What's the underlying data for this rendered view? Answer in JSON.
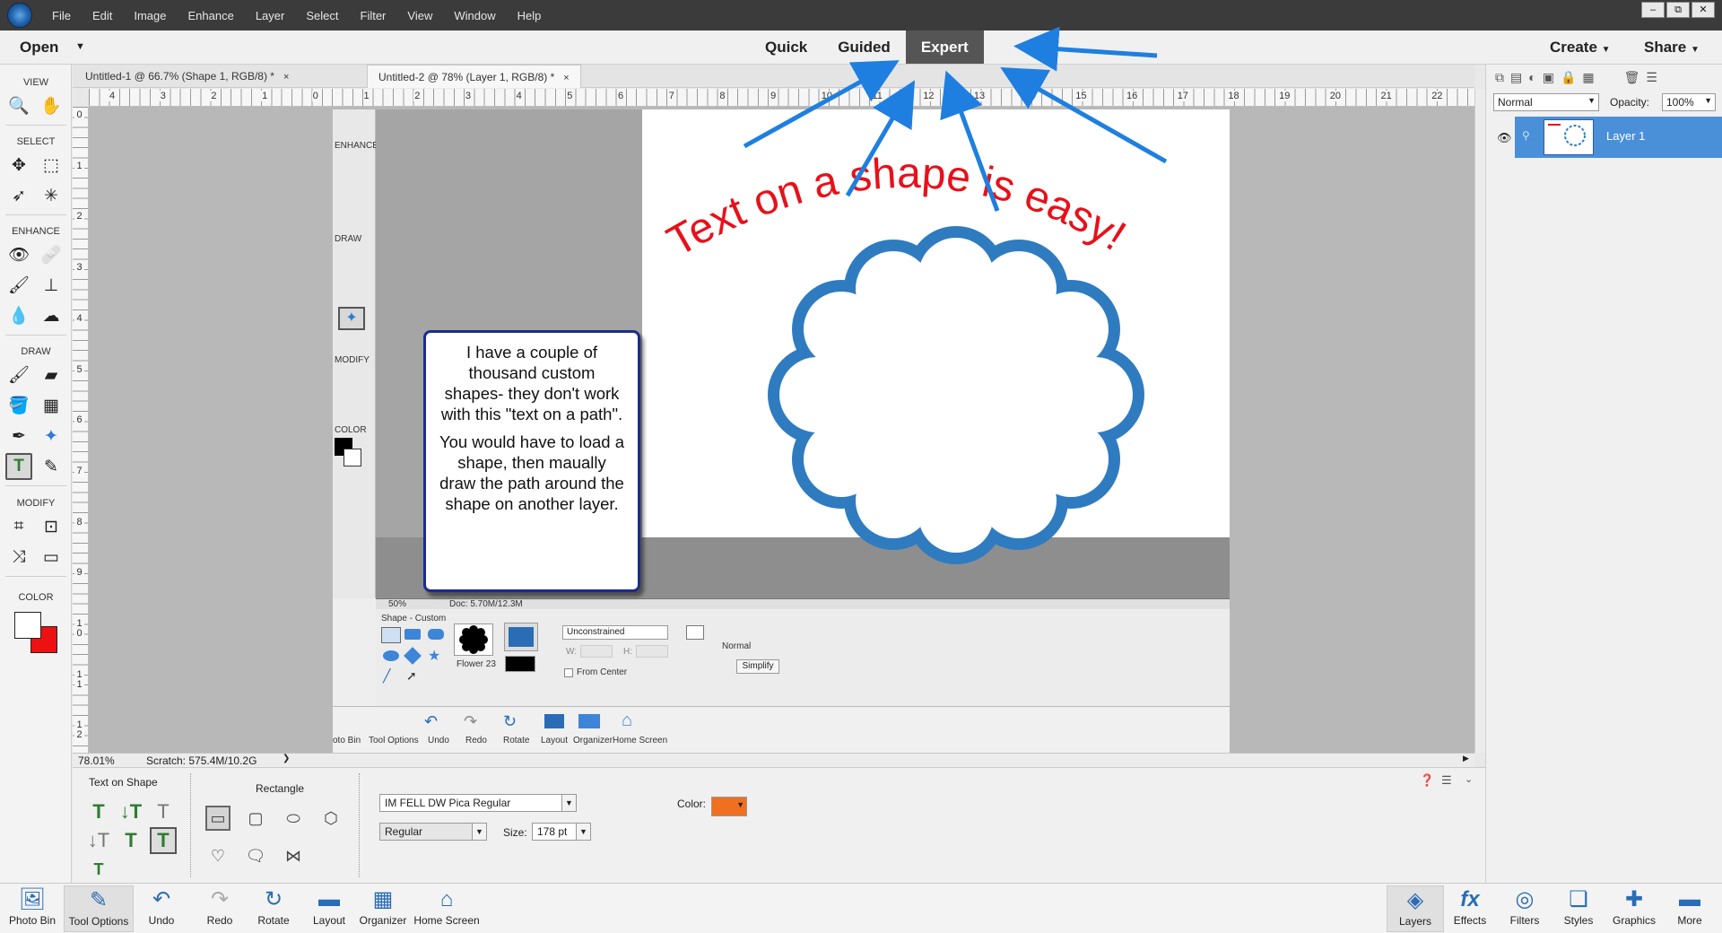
{
  "menu": {
    "items": [
      "File",
      "Edit",
      "Image",
      "Enhance",
      "Layer",
      "Select",
      "Filter",
      "View",
      "Window",
      "Help"
    ],
    "window_controls": [
      "–",
      "⧉",
      "✕"
    ]
  },
  "modebar": {
    "open_label": "Open",
    "tabs": [
      {
        "label": "Quick"
      },
      {
        "label": "Guided"
      },
      {
        "label": "Expert",
        "active": true
      }
    ],
    "create_label": "Create",
    "share_label": "Share"
  },
  "toolbox": {
    "sections": {
      "view": "VIEW",
      "select": "SELECT",
      "enhance": "ENHANCE",
      "draw": "DRAW",
      "modify": "MODIFY",
      "color": "COLOR"
    },
    "foreground_color": "#ffffff",
    "background_color": "#ee1111"
  },
  "documents": {
    "tabs": [
      {
        "title": "Untitled-1 @ 66.7% (Shape 1, RGB/8) *",
        "close": "×"
      },
      {
        "title": "Untitled-2 @ 78% (Layer 1, RGB/8) *",
        "close": "×",
        "active": true
      }
    ]
  },
  "ruler": {
    "h_labels": [
      "4",
      "3",
      "2",
      "1",
      "0",
      "1",
      "2",
      "3",
      "4",
      "5",
      "6",
      "7",
      "8",
      "9",
      "10",
      "11",
      "12",
      "13",
      "14",
      "15",
      "16",
      "17",
      "18",
      "19",
      "20",
      "21",
      "22"
    ],
    "v_labels": [
      "0",
      "1",
      "2",
      "3",
      "4",
      "5",
      "6",
      "7",
      "8",
      "9",
      "1 0",
      "1 1",
      "1 2"
    ]
  },
  "status": {
    "zoom": "78.01%",
    "scratch": "Scratch: 575.4M/10.2G"
  },
  "canvas_image": {
    "curved_text": "Text on a shape is easy!",
    "text_color": "#e8101a",
    "shape_outline_color": "#2f7bc0",
    "callout_paragraphs": [
      "I have a couple of thousand custom shapes- they don't work with this \"text on a path\".",
      "You would have to load a shape, then maually draw the path around the shape on another layer."
    ],
    "inner": {
      "panel_labels": [
        "ENHANCE",
        "DRAW",
        "MODIFY",
        "COLOR"
      ],
      "zoom": "50%",
      "doc": "Doc: 5.70M/12.3M",
      "shape_section": "Shape - Custom",
      "shape_name": "Flower 23",
      "constraint": "Unconstrained",
      "w_label": "W:",
      "h_label": "H:",
      "from_center": "From Center",
      "normal": "Normal",
      "simplify": "Simplify",
      "bottom_items": [
        "oto Bin",
        "Tool Options",
        "Undo",
        "Redo",
        "Rotate",
        "Layout",
        "Organizer",
        "Home Screen"
      ]
    }
  },
  "layers": {
    "blend_mode": "Normal",
    "opacity_label": "Opacity:",
    "opacity_value": "100%",
    "layer_name": "Layer 1"
  },
  "options": {
    "tool_name": "Text on Shape",
    "shape_label": "Rectangle",
    "font": "IM FELL DW Pica Regular",
    "style": "Regular",
    "size_label": "Size:",
    "size_value": "178 pt",
    "color_label": "Color:",
    "text_color": "#f07020"
  },
  "taskbar": {
    "left": [
      {
        "label": "Photo Bin",
        "icon": "photo-bin-icon"
      },
      {
        "label": "Tool Options",
        "icon": "tool-options-icon"
      },
      {
        "label": "Undo",
        "icon": "undo-icon"
      },
      {
        "label": "Redo",
        "icon": "redo-icon"
      },
      {
        "label": "Rotate",
        "icon": "rotate-icon"
      },
      {
        "label": "Layout",
        "icon": "layout-icon"
      },
      {
        "label": "Organizer",
        "icon": "organizer-icon"
      },
      {
        "label": "Home Screen",
        "icon": "home-icon"
      }
    ],
    "right": [
      {
        "label": "Layers",
        "icon": "layers-icon"
      },
      {
        "label": "Effects",
        "icon": "effects-icon"
      },
      {
        "label": "Filters",
        "icon": "filters-icon"
      },
      {
        "label": "Styles",
        "icon": "styles-icon"
      },
      {
        "label": "Graphics",
        "icon": "graphics-icon"
      },
      {
        "label": "More",
        "icon": "more-icon"
      }
    ]
  },
  "arrow_color": "#1e7fe0"
}
